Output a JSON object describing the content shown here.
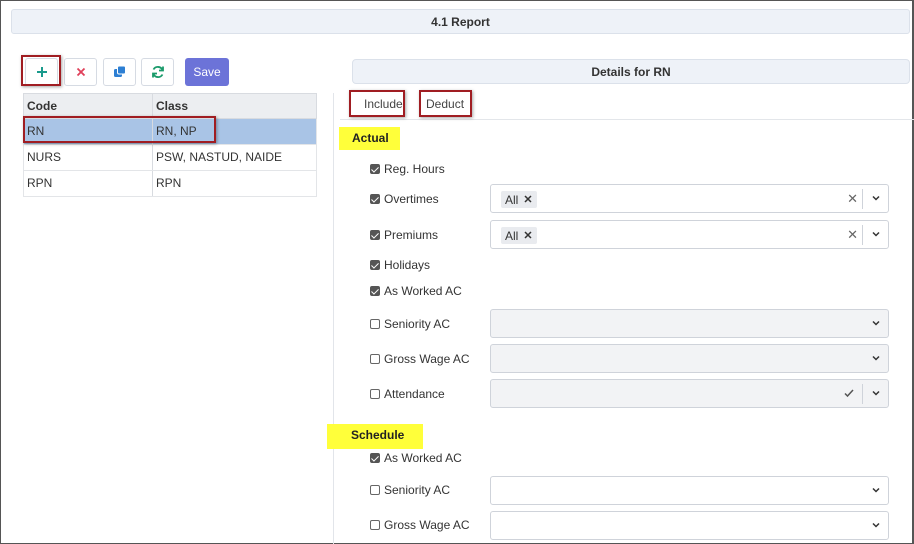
{
  "window": {
    "title": "4.1 Report"
  },
  "toolbar": {
    "save_label": "Save"
  },
  "grid": {
    "columns": [
      "Code",
      "Class"
    ],
    "rows": [
      {
        "code": "RN",
        "class": "RN, NP"
      },
      {
        "code": "NURS",
        "class": "PSW, NASTUD, NAIDE"
      },
      {
        "code": "RPN",
        "class": "RPN"
      }
    ]
  },
  "details": {
    "title": "Details for RN",
    "tabs": [
      "Include",
      "Deduct"
    ],
    "actual": {
      "heading": "Actual",
      "items": [
        {
          "label": "Reg. Hours",
          "checked": true
        },
        {
          "label": "Overtimes",
          "checked": true,
          "chip": "All"
        },
        {
          "label": "Premiums",
          "checked": true,
          "chip": "All"
        },
        {
          "label": "Holidays",
          "checked": true
        },
        {
          "label": "As Worked AC",
          "checked": true
        },
        {
          "label": "Seniority AC",
          "checked": false
        },
        {
          "label": "Gross Wage AC",
          "checked": false
        },
        {
          "label": "Attendance",
          "checked": false
        }
      ]
    },
    "schedule": {
      "heading": "Schedule",
      "items": [
        {
          "label": "As Worked AC",
          "checked": true
        },
        {
          "label": "Seniority AC",
          "checked": false
        },
        {
          "label": "Gross Wage AC",
          "checked": false
        }
      ]
    }
  },
  "colors": {
    "accent": "#6c73d8",
    "selected_row": "#a9c4e6",
    "highlight": "#ffff3a",
    "annotation": "#a01d22"
  }
}
